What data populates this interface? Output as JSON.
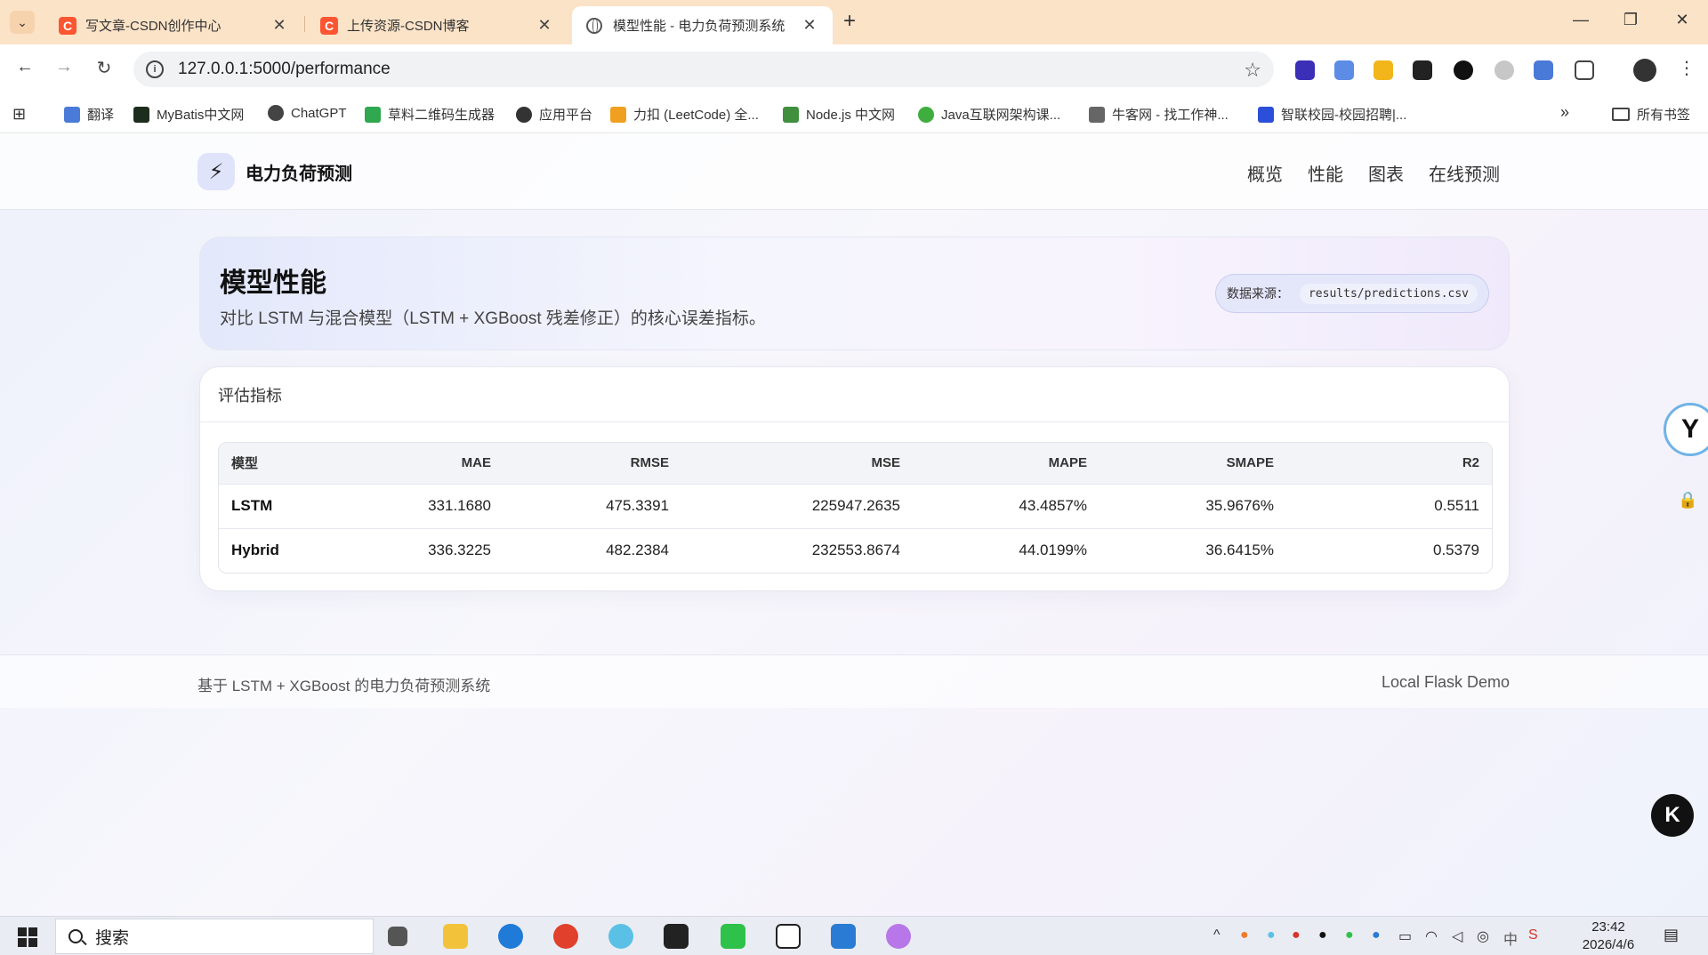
{
  "browser": {
    "tabs": [
      {
        "title": "写文章-CSDN创作中心",
        "favicon": "C"
      },
      {
        "title": "上传资源-CSDN博客",
        "favicon": "C"
      },
      {
        "title": "模型性能 - 电力负荷预测系统",
        "favicon": "globe"
      }
    ],
    "url": "127.0.0.1:5000/performance",
    "bookmarks": [
      {
        "label": "翻译",
        "color": "#4a7bd8"
      },
      {
        "label": "MyBatis中文网",
        "color": "#1d2d1d"
      },
      {
        "label": "ChatGPT",
        "color": "#444444"
      },
      {
        "label": "草料二维码生成器",
        "color": "#2fa84f"
      },
      {
        "label": "应用平台",
        "color": "#333333"
      },
      {
        "label": "力扣 (LeetCode) 全...",
        "color": "#f0a020"
      },
      {
        "label": "Node.js 中文网",
        "color": "#3f8f3f"
      },
      {
        "label": "Java互联网架构课...",
        "color": "#3fae3f"
      },
      {
        "label": "牛客网 - 找工作神...",
        "color": "#666666"
      },
      {
        "label": "智联校园-校园招聘|...",
        "color": "#2b4fd8"
      }
    ],
    "bookmarks_folder": "所有书签"
  },
  "site": {
    "brand": "电力负荷预测",
    "nav": [
      "概览",
      "性能",
      "图表",
      "在线预测"
    ]
  },
  "hero": {
    "title": "模型性能",
    "subtitle": "对比 LSTM 与混合模型（LSTM + XGBoost 残差修正）的核心误差指标。",
    "source_label": "数据来源：",
    "source_file": "results/predictions.csv"
  },
  "metrics": {
    "card_title": "评估指标",
    "columns": [
      "模型",
      "MAE",
      "RMSE",
      "MSE",
      "MAPE",
      "SMAPE",
      "R2"
    ],
    "rows": [
      [
        "LSTM",
        "331.1680",
        "475.3391",
        "225947.2635",
        "43.4857%",
        "35.9676%",
        "0.5511"
      ],
      [
        "Hybrid",
        "336.3225",
        "482.2384",
        "232553.8674",
        "44.0199%",
        "36.6415%",
        "0.5379"
      ]
    ]
  },
  "footer": {
    "left": "基于 LSTM + XGBoost 的电力负荷预测系统",
    "right": "Local Flask Demo"
  },
  "taskbar": {
    "search_placeholder": "搜索",
    "time": "23:42",
    "date": "2026/4/6"
  }
}
